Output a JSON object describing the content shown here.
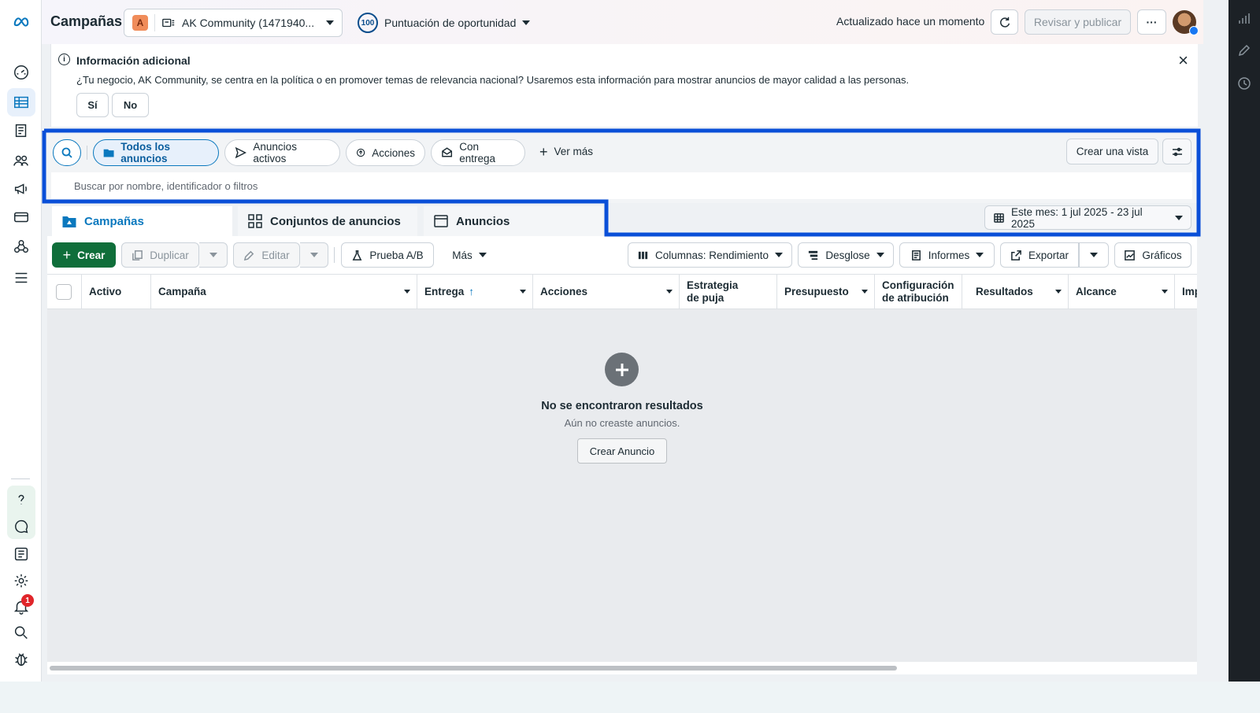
{
  "header": {
    "title": "Campañas",
    "account_initial": "A",
    "account_name": "AK Community (1471940...",
    "score_value": "100",
    "score_label": "Puntuación de oportunidad",
    "updated_text": "Actualizado hace un momento",
    "publish_label": "Revisar y publicar",
    "more_label": "···"
  },
  "info_banner": {
    "title": "Información adicional",
    "text": "¿Tu negocio, AK Community, se centra en la política o en promover temas de relevancia nacional? Usaremos esta información para mostrar anuncios de mayor calidad a las personas.",
    "yes_label": "Sí",
    "no_label": "No",
    "close_label": "×"
  },
  "filters": {
    "chips": [
      "Todos los anuncios",
      "Anuncios activos",
      "Acciones",
      "Con entrega"
    ],
    "ver_mas": "Ver más",
    "crear_vista": "Crear una vista",
    "search_placeholder": "Buscar por nombre, identificador o filtros"
  },
  "level_tabs": [
    "Campañas",
    "Conjuntos de anuncios",
    "Anuncios"
  ],
  "date_range": "Este mes: 1 jul 2025 - 23 jul 2025",
  "toolbar": {
    "create": "Crear",
    "duplicate": "Duplicar",
    "edit": "Editar",
    "ab_test": "Prueba A/B",
    "more": "Más",
    "columns": "Columnas: Rendimiento",
    "breakdown": "Desglose",
    "reports": "Informes",
    "export": "Exportar",
    "charts": "Gráficos"
  },
  "table": {
    "columns": [
      "Activo",
      "Campaña",
      "Entrega",
      "Acciones",
      "Estrategia de puja",
      "Presupuesto",
      "Configuración de atribución",
      "Resultados",
      "Alcance",
      "Imp"
    ],
    "sort_arrow": "↑"
  },
  "empty_state": {
    "title": "No se encontraron resultados",
    "subtitle": "Aún no creaste anuncios.",
    "button": "Crear Anuncio"
  },
  "notifications_count": "1",
  "colors": {
    "accent": "#0a78be",
    "highlight": "#0a4fd8",
    "create_green": "#0f6e3a"
  }
}
